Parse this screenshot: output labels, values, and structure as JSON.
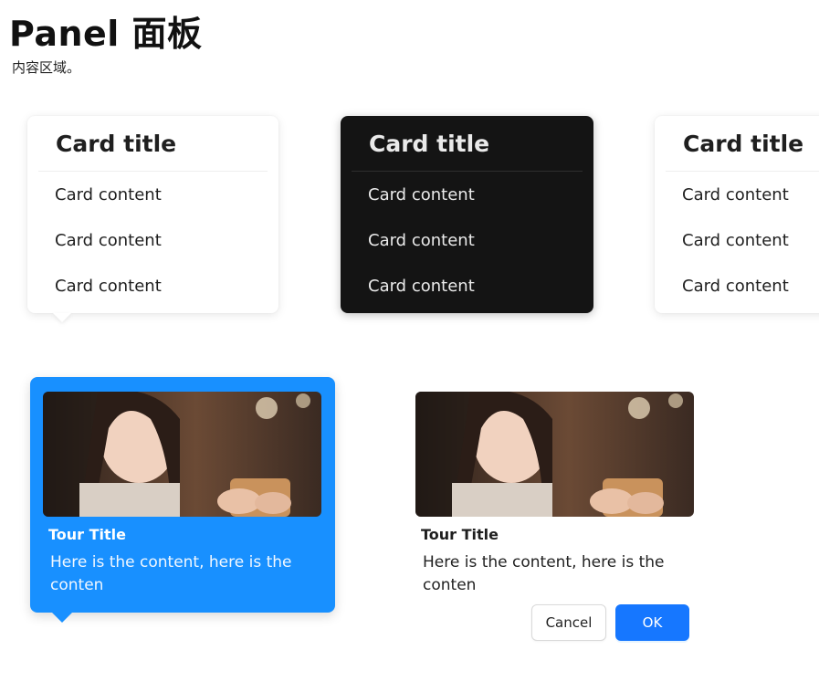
{
  "header": {
    "title": "Panel 面板",
    "subtitle": "内容区域。"
  },
  "cards": [
    {
      "theme": "light",
      "title": "Card title",
      "rows": [
        "Card content",
        "Card content",
        "Card content"
      ]
    },
    {
      "theme": "dark",
      "title": "Card title",
      "rows": [
        "Card content",
        "Card content",
        "Card content"
      ]
    },
    {
      "theme": "light",
      "title": "Card title",
      "rows": [
        "Card content",
        "Card content",
        "Card content"
      ]
    }
  ],
  "tours": [
    {
      "variant": "primary",
      "title": "Tour Title",
      "description": "Here is the content, here is the conten"
    },
    {
      "variant": "default",
      "title": "Tour Title",
      "description": "Here is the content, here is the conten"
    }
  ],
  "actions": {
    "cancel_label": "Cancel",
    "ok_label": "OK"
  },
  "colors": {
    "primary": "#1890ff",
    "dark_card": "#141414",
    "button_primary": "#1677ff"
  }
}
